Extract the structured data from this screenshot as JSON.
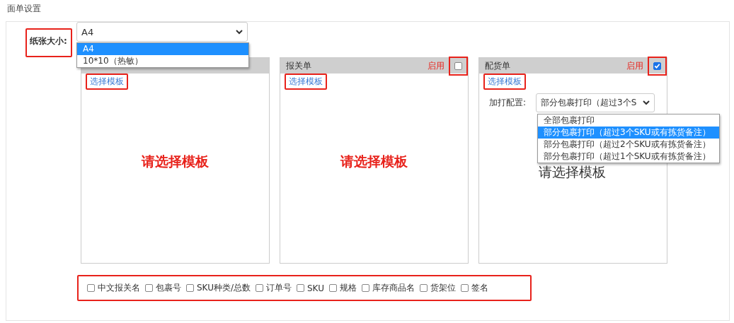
{
  "page_title": "面单设置",
  "paper_size": {
    "label": "纸张大小:",
    "highlighted": true,
    "value": "A4",
    "expanded": true,
    "options": [
      {
        "label": "A4",
        "selected": true
      },
      {
        "label": "10*10（热敏）",
        "selected": false
      }
    ]
  },
  "panels": [
    {
      "link": "选择模板",
      "link_highlighted": true,
      "empty_text": "请选择模板",
      "emphasized": true
    },
    {
      "title": "报关单",
      "enable_label": "启用",
      "enabled": false,
      "enable_highlighted": true,
      "link": "选择模板",
      "link_highlighted": true,
      "empty_text": "请选择模板",
      "emphasized": true
    },
    {
      "title": "配货单",
      "enable_label": "启用",
      "enabled": true,
      "enable_highlighted": true,
      "link": "选择模板",
      "link_highlighted": true,
      "empty_text": "请选择模板",
      "emphasized": false,
      "print_config": {
        "label": "加打配置:",
        "value": "部分包裹打印（超过3个S",
        "expanded": true,
        "options": [
          {
            "label": "全部包裹打印",
            "selected": false
          },
          {
            "label": "部分包裹打印（超过3个SKU或有拣货备注）",
            "selected": true
          },
          {
            "label": "部分包裹打印（超过2个SKU或有拣货备注）",
            "selected": false
          },
          {
            "label": "部分包裹打印（超过1个SKU或有拣货备注）",
            "selected": false
          }
        ]
      }
    }
  ],
  "fields": {
    "highlighted": true,
    "items": [
      {
        "label": "中文报关名",
        "checked": false
      },
      {
        "label": "包裹号",
        "checked": false
      },
      {
        "label": "SKU种类/总数",
        "checked": false
      },
      {
        "label": "订单号",
        "checked": false
      },
      {
        "label": "SKU",
        "checked": false
      },
      {
        "label": "规格",
        "checked": false
      },
      {
        "label": "库存商品名",
        "checked": false
      },
      {
        "label": "货架位",
        "checked": false
      },
      {
        "label": "签名",
        "checked": false
      }
    ]
  }
}
